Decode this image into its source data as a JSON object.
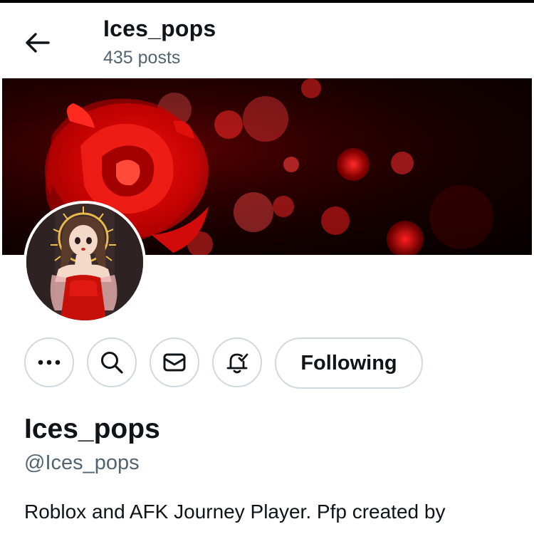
{
  "header": {
    "name": "Ices_pops",
    "posts_count": "435 posts"
  },
  "icons": {
    "back": "arrow-left-icon",
    "more": "more-dots-icon",
    "search": "search-icon",
    "message": "mail-icon",
    "notifications": "bell-check-icon"
  },
  "profile": {
    "display_name": "Ices_pops",
    "handle": "@Ices_pops",
    "bio": "Roblox and AFK Journey Player. Pfp created by"
  },
  "actions": {
    "following_label": "Following"
  },
  "colors": {
    "text_primary": "#0f1419",
    "text_secondary": "#536471",
    "button_border": "#cfd9de",
    "banner_accent": "#e00000"
  }
}
